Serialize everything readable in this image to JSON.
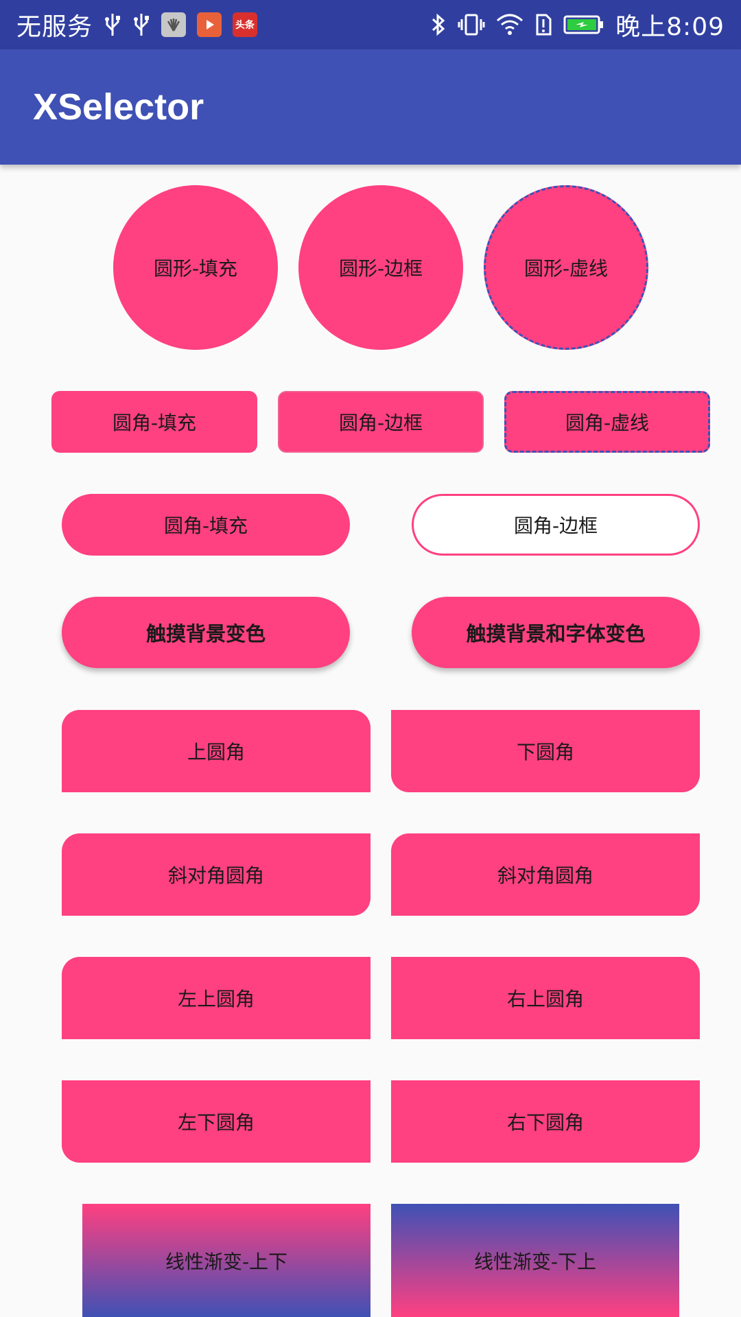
{
  "status_bar": {
    "carrier": "无服务",
    "time": "晚上8:09",
    "app_icon_toutiao": "头条"
  },
  "app_bar": {
    "title": "XSelector"
  },
  "circles": [
    "圆形-填充",
    "圆形-边框",
    "圆形-虚线"
  ],
  "rounded": [
    "圆角-填充",
    "圆角-边框",
    "圆角-虚线"
  ],
  "pills": [
    "圆角-填充",
    "圆角-边框"
  ],
  "touch": [
    "触摸背景变色",
    "触摸背景和字体变色"
  ],
  "corners": {
    "top": "上圆角",
    "bottom": "下圆角",
    "diag1": "斜对角圆角",
    "diag2": "斜对角圆角",
    "top_left": "左上圆角",
    "top_right": "右上圆角",
    "bottom_left": "左下圆角",
    "bottom_right": "右下圆角"
  },
  "gradients": [
    "线性渐变-上下",
    "线性渐变-下上"
  ],
  "colors": {
    "accent": "#ff4081",
    "primary": "#3f51b5",
    "primary_dark": "#303f9f"
  }
}
